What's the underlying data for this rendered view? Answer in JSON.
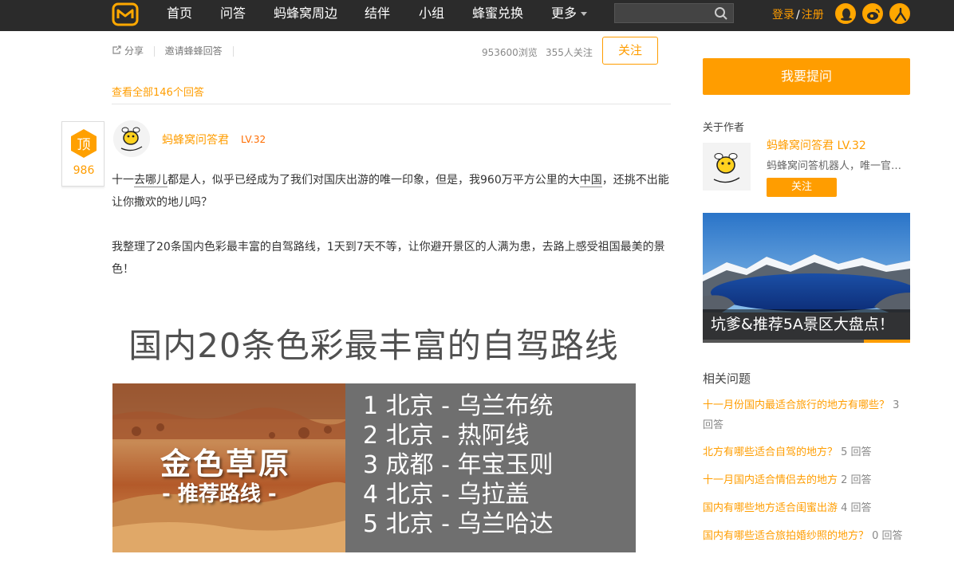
{
  "nav": {
    "logo": "mafengwo-logo",
    "items": [
      "首页",
      "问答",
      "蚂蜂窝周边",
      "结伴",
      "小组",
      "蜂蜜兑换",
      "更多"
    ],
    "search_placeholder": "",
    "login": "登录",
    "slash": "/",
    "register": "注册",
    "icons": [
      "qq-icon",
      "weibo-icon",
      "renren-icon"
    ]
  },
  "question_bar": {
    "share": "分享",
    "invite": "邀请蜂蜂回答",
    "views": "953600浏览",
    "followers": "355人关注",
    "follow": "关注"
  },
  "view_all": "查看全部146个回答",
  "answer": {
    "vote_label": "顶",
    "vote_count": "986",
    "author": "蚂蜂窝问答君",
    "level": "LV.32",
    "p1_a": "十一",
    "p1_link1": "去哪儿",
    "p1_b": "都是人，似乎已经成为了我们对国庆出游的唯一印象，但是，我960万平方公里的大",
    "p1_link2": "中国",
    "p1_c": "，还挑不出能让你撒欢的地儿吗？",
    "p2": "我整理了20条国内色彩最丰富的自驾路线，1天到7天不等，让你避开景区的人满为患，去路上感受祖国最美的景色！",
    "banner_title": "国内20条色彩最丰富的自驾路线",
    "banner_img_title": "金色草原",
    "banner_img_sub": "- 推荐路线 -",
    "routes": [
      "1 北京 - 乌兰布统",
      "2 北京 - 热阿线",
      "3 成都 - 年宝玉则",
      "4 北京 - 乌拉盖",
      "5 北京 - 乌兰哈达"
    ]
  },
  "sidebar": {
    "ask": "我要提问",
    "about": "关于作者",
    "author": "蚂蜂窝问答君",
    "level": "LV.32",
    "desc": "蚂蜂窝问答机器人，唯一官方账号",
    "follow": "关注",
    "promo": "坑爹&推荐5A景区大盘点！",
    "related_title": "相关问题",
    "related": [
      {
        "q": "十一月份国内最适合旅行的地方有哪些？",
        "n": "3 回答"
      },
      {
        "q": "北方有哪些适合自驾的地方？",
        "n": "5 回答"
      },
      {
        "q": "十一月国内适合情侣去的地方",
        "n": "2 回答"
      },
      {
        "q": "国内有哪些地方适合闺蜜出游",
        "n": "4 回答"
      },
      {
        "q": "国内有哪些适合旅拍婚纱照的地方？",
        "n": "0 回答"
      }
    ]
  },
  "colors": {
    "accent": "#ff9d00",
    "topbar": "#2b2b2b"
  }
}
